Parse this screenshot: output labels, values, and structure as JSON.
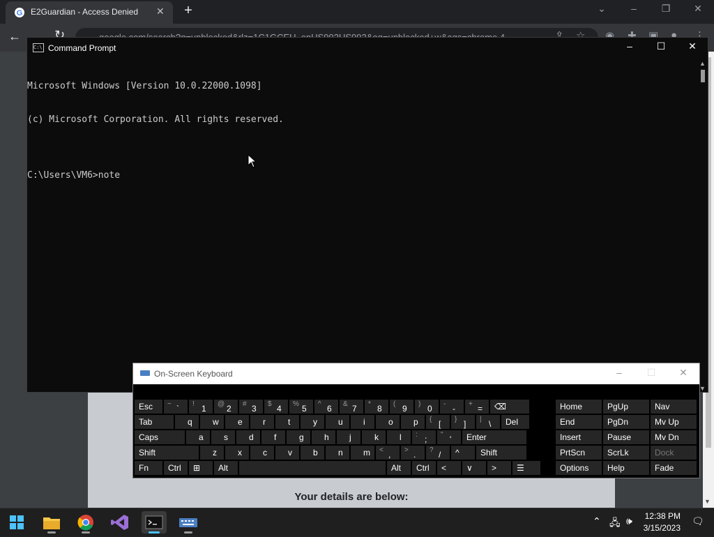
{
  "browser": {
    "tab_title": "E2Guardian - Access Denied",
    "tab_close": "✕",
    "new_tab": "+",
    "url": "google.com/search?q=unblocked&rlz=1C1GCEU_enUS992US992&oq=unblocked+w&aqs=chrome.4...",
    "page_heading": "Your details are below:"
  },
  "cmd": {
    "title": "Command Prompt",
    "icon_text": "C:\\",
    "lines": [
      "Microsoft Windows [Version 10.0.22000.1098]",
      "(c) Microsoft Corporation. All rights reserved.",
      "",
      "C:\\Users\\VM6>note"
    ]
  },
  "osk": {
    "title": "On-Screen Keyboard",
    "rows": [
      [
        {
          "main": "Esc"
        },
        {
          "shift": "~",
          "main": "`"
        },
        {
          "shift": "!",
          "main": "1"
        },
        {
          "shift": "@",
          "main": "2"
        },
        {
          "shift": "#",
          "main": "3"
        },
        {
          "shift": "$",
          "main": "4"
        },
        {
          "shift": "%",
          "main": "5"
        },
        {
          "shift": "^",
          "main": "6"
        },
        {
          "shift": "&",
          "main": "7"
        },
        {
          "shift": "*",
          "main": "8"
        },
        {
          "shift": "(",
          "main": "9"
        },
        {
          "shift": ")",
          "main": "0"
        },
        {
          "shift": "-",
          "main": "-"
        },
        {
          "shift": "+",
          "main": "="
        },
        {
          "main": "⌫"
        }
      ],
      [
        {
          "main": "Tab"
        },
        {
          "main": "q"
        },
        {
          "main": "w"
        },
        {
          "main": "e"
        },
        {
          "main": "r"
        },
        {
          "main": "t"
        },
        {
          "main": "y"
        },
        {
          "main": "u"
        },
        {
          "main": "i"
        },
        {
          "main": "o"
        },
        {
          "main": "p"
        },
        {
          "shift": "{",
          "main": "["
        },
        {
          "shift": "}",
          "main": "]"
        },
        {
          "shift": "|",
          "main": "\\"
        },
        {
          "main": "Del"
        }
      ],
      [
        {
          "main": "Caps"
        },
        {
          "main": "a"
        },
        {
          "main": "s"
        },
        {
          "main": "d"
        },
        {
          "main": "f"
        },
        {
          "main": "g"
        },
        {
          "main": "h"
        },
        {
          "main": "j"
        },
        {
          "main": "k"
        },
        {
          "main": "l"
        },
        {
          "shift": ":",
          "main": ";"
        },
        {
          "shift": "\"",
          "main": "'"
        },
        {
          "main": "Enter"
        }
      ],
      [
        {
          "main": "Shift"
        },
        {
          "main": "z"
        },
        {
          "main": "x"
        },
        {
          "main": "c"
        },
        {
          "main": "v"
        },
        {
          "main": "b"
        },
        {
          "main": "n"
        },
        {
          "main": "m"
        },
        {
          "shift": "<",
          "main": ","
        },
        {
          "shift": ">",
          "main": "."
        },
        {
          "shift": "?",
          "main": "/"
        },
        {
          "main": "^"
        },
        {
          "main": "Shift"
        }
      ],
      [
        {
          "main": "Fn"
        },
        {
          "main": "Ctrl"
        },
        {
          "main": "⊞"
        },
        {
          "main": "Alt"
        },
        {
          "main": ""
        },
        {
          "main": "Alt"
        },
        {
          "main": "Ctrl"
        },
        {
          "main": "<"
        },
        {
          "main": "∨"
        },
        {
          "main": ">"
        },
        {
          "main": "☰"
        }
      ]
    ],
    "nav_rows": [
      [
        "Home",
        "PgUp",
        "Nav"
      ],
      [
        "End",
        "PgDn",
        "Mv Up"
      ],
      [
        "Insert",
        "Pause",
        "Mv Dn"
      ],
      [
        "PrtScn",
        "ScrLk",
        "Dock"
      ],
      [
        "Options",
        "Help",
        "Fade"
      ]
    ]
  },
  "taskbar": {
    "time": "12:38 PM",
    "date": "3/15/2023",
    "apps": [
      "start-icon",
      "file-explorer-icon",
      "chrome-icon",
      "visual-studio-icon",
      "command-prompt-icon",
      "on-screen-keyboard-icon"
    ]
  },
  "colors": {
    "cmd_bg": "#0c0c0c",
    "osk_key": "#262626",
    "accent": "#4cc2ff"
  }
}
